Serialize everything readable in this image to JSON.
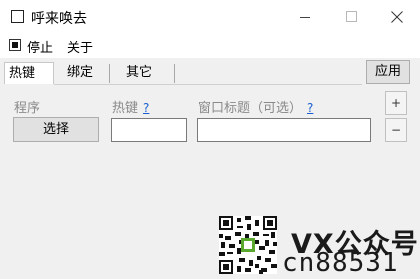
{
  "window": {
    "title": "呼来唤去"
  },
  "menu": {
    "stop_label": "停止",
    "about_label": "关于",
    "stop_checked": true
  },
  "tabs": [
    {
      "label": "热键"
    },
    {
      "label": "绑定"
    },
    {
      "label": "其它"
    }
  ],
  "toolbar": {
    "apply_label": "应用"
  },
  "form": {
    "program_label": "程序",
    "hotkey_label": "热键",
    "title_label": "窗口标题（可选）",
    "help_label": "?",
    "select_label": "选择",
    "hotkey_value": "",
    "title_value": ""
  },
  "spin": {
    "add_label": "+",
    "remove_label": "−"
  },
  "watermark": {
    "line1": "VX公众号",
    "line2": "cn88531",
    "qr_icon": "qr-code-icon"
  }
}
